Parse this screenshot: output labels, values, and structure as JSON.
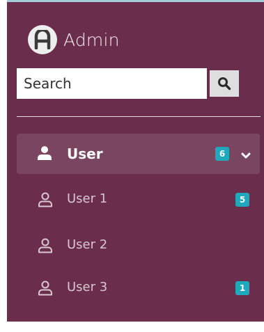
{
  "brand": {
    "title": "Admin",
    "logo_letter": "A"
  },
  "search": {
    "placeholder": "Search",
    "value": "",
    "button_icon": "search-icon"
  },
  "nav": {
    "parent": {
      "label": "User",
      "badge": "6",
      "icon": "user-solid-icon",
      "expanded": true
    },
    "children": [
      {
        "label": "User 1",
        "badge": "5",
        "icon": "user-outline-icon"
      },
      {
        "label": "User 2",
        "badge": "",
        "icon": "user-outline-icon"
      },
      {
        "label": "User 3",
        "badge": "1",
        "icon": "user-outline-icon"
      }
    ]
  },
  "colors": {
    "sidebar_bg": "#6b2d4c",
    "active_item_bg": "#7a4560",
    "badge_bg": "#1fa9bd",
    "top_border": "#a3cdd9"
  }
}
